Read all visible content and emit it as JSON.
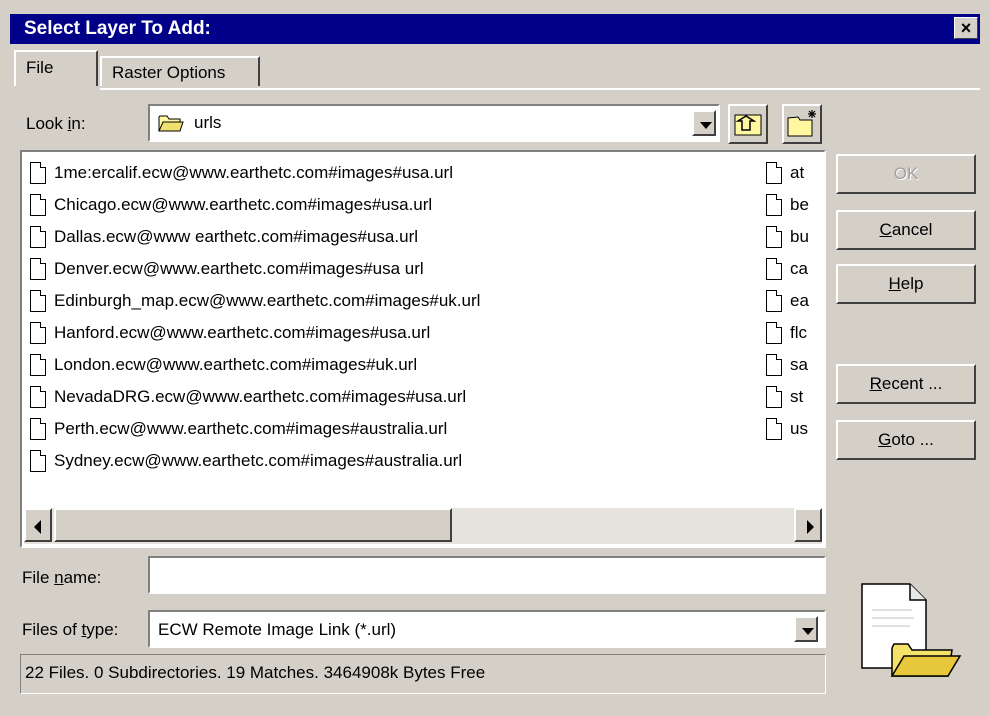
{
  "window": {
    "title": "Select Layer To Add:",
    "close_label": "×"
  },
  "tabs": [
    {
      "label": "File"
    },
    {
      "label": "Raster Options"
    }
  ],
  "look_in": {
    "label_pre": "Look ",
    "label_key": "i",
    "label_post": "n:",
    "value": "urls"
  },
  "files": {
    "col1": [
      "1me:ercalif.ecw@www.earthetc.com#images#usa.url",
      "Chicago.ecw@www.earthetc.com#images#usa.url",
      "Dallas.ecw@www earthetc.com#images#usa.url",
      "Denver.ecw@www.earthetc.com#images#usa url",
      "Edinburgh_map.ecw@www.earthetc.com#images#uk.url",
      "Hanford.ecw@www.earthetc.com#images#usa.url",
      "London.ecw@www.earthetc.com#images#uk.url",
      "NevadaDRG.ecw@www.earthetc.com#images#usa.url",
      "Perth.ecw@www.earthetc.com#images#australia.url",
      "Sydney.ecw@www.earthetc.com#images#australia.url"
    ],
    "col2": [
      "at",
      "be",
      "bu",
      "ca",
      "ea",
      "flc",
      "sa",
      "st",
      "us"
    ]
  },
  "buttons": {
    "ok": "OK",
    "cancel_key": "C",
    "cancel_rest": "ancel",
    "help_key": "H",
    "help_rest": "elp",
    "recent_key": "R",
    "recent_rest": "ecent ...",
    "goto_key": "G",
    "goto_rest": "oto ..."
  },
  "file_name": {
    "label_pre": "File ",
    "label_key": "n",
    "label_post": "ame:",
    "value": ""
  },
  "files_of_type": {
    "label_pre": "Files of ",
    "label_key": "t",
    "label_post": "ype:",
    "value": "ECW Remote Image Link (*.url)"
  },
  "status_text": "22 Files. 0 Subdirectories. 19 Matches. 3464908k Bytes Free",
  "colors": {
    "title_bar": "#000088",
    "face": "#d4d0c8"
  }
}
